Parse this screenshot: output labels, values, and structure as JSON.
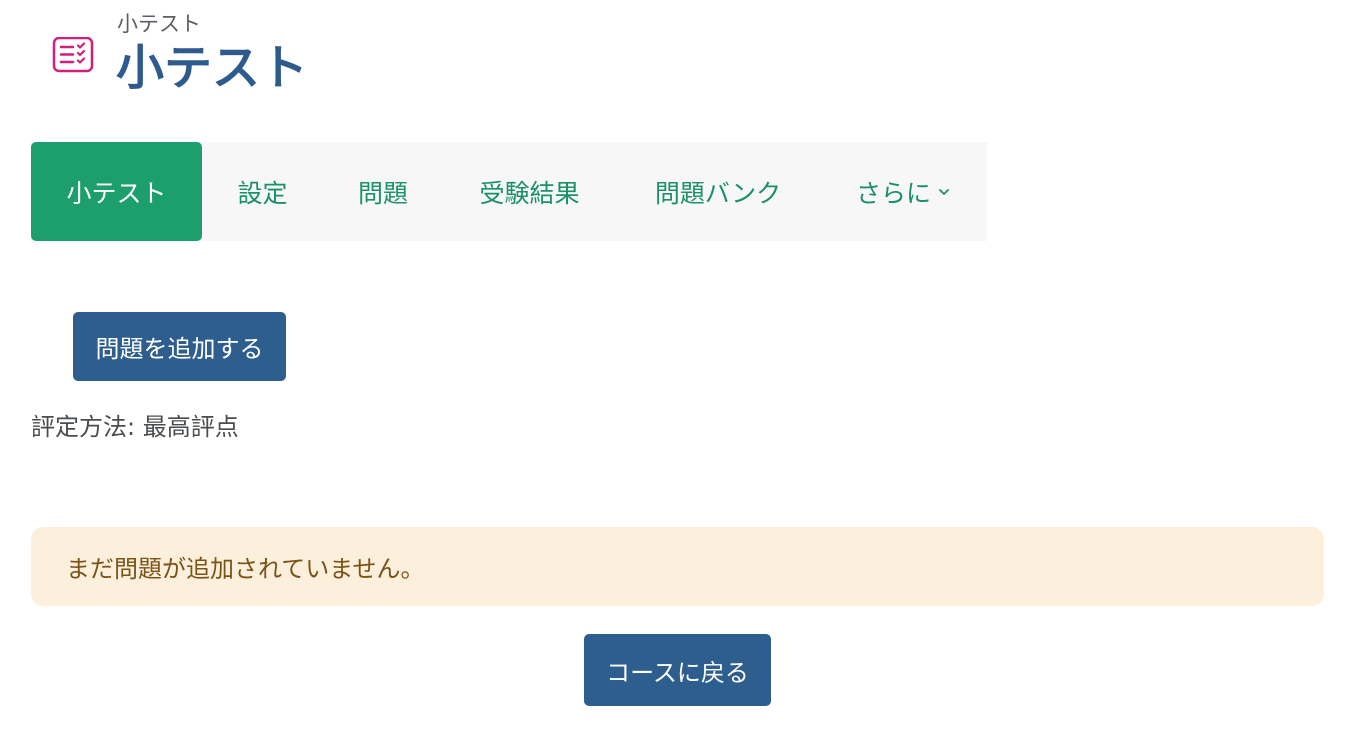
{
  "header": {
    "pretitle": "小テスト",
    "title": "小テスト",
    "icon": "quiz-checklist-icon",
    "icon_color": "#d1207c"
  },
  "tabs": [
    {
      "label": "小テスト",
      "active": true
    },
    {
      "label": "設定",
      "active": false
    },
    {
      "label": "問題",
      "active": false
    },
    {
      "label": "受験結果",
      "active": false
    },
    {
      "label": "問題バンク",
      "active": false
    },
    {
      "label": "さらに",
      "active": false,
      "has_dropdown": true
    }
  ],
  "main": {
    "add_question_label": "問題を追加する",
    "grading_method": "評定方法: 最高評点",
    "alert_message": "まだ問題が追加されていません。",
    "back_to_course_label": "コースに戻る"
  },
  "colors": {
    "primary": "#2e5e8e",
    "tab_active": "#1d9f6d",
    "tab_text": "#1b9167",
    "alert_bg": "#fcefdc",
    "alert_text": "#7a5317"
  }
}
